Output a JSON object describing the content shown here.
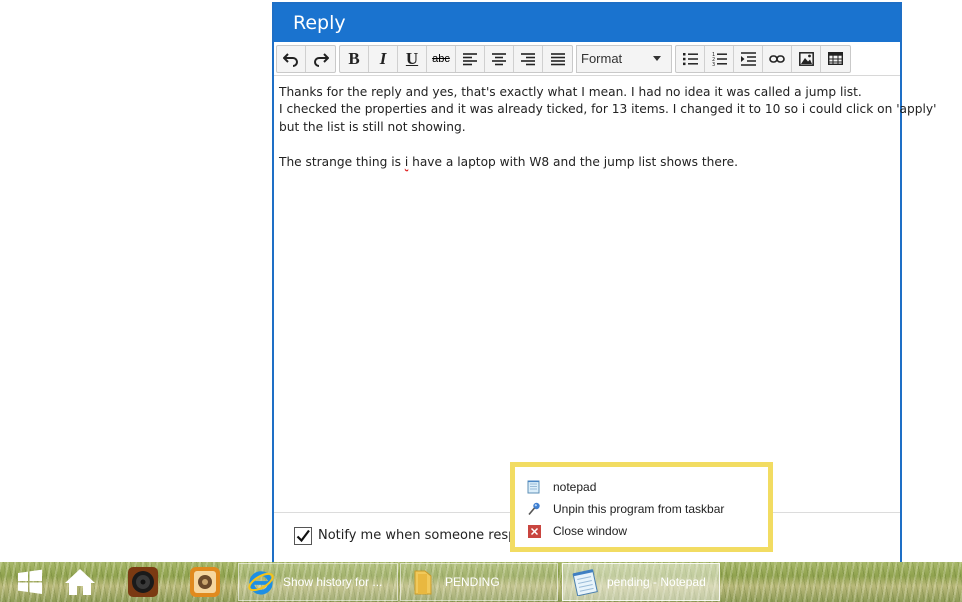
{
  "reply": {
    "title": "Reply",
    "format_label": "Format",
    "toolbar_icons": [
      "undo-icon",
      "redo-icon",
      "bold-icon",
      "italic-icon",
      "underline-icon",
      "strikethrough-icon",
      "align-left-icon",
      "align-center-icon",
      "align-right-icon",
      "align-justify-icon",
      "bullet-list-icon",
      "numbered-list-icon",
      "indent-icon",
      "link-icon",
      "image-icon",
      "table-icon"
    ],
    "toolbar_labels": {
      "bold": "B",
      "italic": "I",
      "underline": "U",
      "strike": "abc"
    },
    "body": {
      "line1": "Thanks for the reply and yes, that's exactly what I mean. I had no idea it was called a jump list.",
      "line2": "I checked the properties and it was already ticked, for 13 items. I changed it to 10 so i could click on 'apply'",
      "line3": "but the list is still not showing.",
      "line4_pre": "The strange thing is ",
      "line4_mark": "i",
      "line4_post": " have a laptop with W8 and the jump list shows there."
    },
    "notify_label": "Notify me when someone respon",
    "notify_checked": true
  },
  "jump_list": {
    "items": [
      {
        "label": "notepad",
        "icon": "notepad-icon"
      },
      {
        "label": "Unpin this program from taskbar",
        "icon": "pin-icon"
      },
      {
        "label": "Close window",
        "icon": "close-icon"
      }
    ]
  },
  "taskbar": {
    "pinned": [
      "start-icon",
      "home-icon",
      "speaker-icon",
      "app-icon"
    ],
    "tasks": [
      {
        "label": "Show history for ...",
        "icon": "ie-icon",
        "active": false
      },
      {
        "label": "PENDING",
        "icon": "folder-icon",
        "active": false
      },
      {
        "label": "pending - Notepad",
        "icon": "notepad-icon",
        "active": true
      }
    ]
  },
  "colors": {
    "accent": "#1a73cf",
    "jump_list_border": "#f2dc62"
  }
}
